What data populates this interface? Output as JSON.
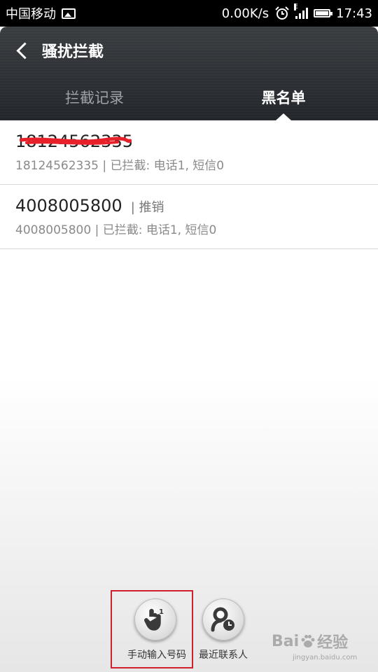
{
  "status_bar": {
    "carrier": "中国移动",
    "speed": "0.00K/s",
    "network": "E",
    "time": "17:43",
    "icons": [
      "image-icon",
      "alarm-clock-icon",
      "signal-icon",
      "battery-icon"
    ]
  },
  "header": {
    "title": "骚扰拦截",
    "tabs": [
      {
        "label": "拦截记录",
        "active": false
      },
      {
        "label": "黑名单",
        "active": true
      }
    ]
  },
  "blacklist": [
    {
      "number": "18124562335",
      "tag": "",
      "detail": "18124562335 | 已拦截: 电话1, 短信0",
      "redacted": true
    },
    {
      "number": "4008005800",
      "tag": "| 推销",
      "detail": "4008005800 | 已拦截: 电话1, 短信0",
      "redacted": false
    }
  ],
  "actions": [
    {
      "label": "手动输入号码",
      "icon": "hand-keypad-icon",
      "highlighted": true
    },
    {
      "label": "最近联系人",
      "icon": "recent-contact-icon",
      "highlighted": false
    }
  ],
  "colors": {
    "header_bg": "#2c2f33",
    "highlight_box": "#d0202a",
    "redaction": "#e8202a"
  },
  "watermark": {
    "brand": "Bai",
    "brand2": "经验",
    "url": "jingyan.baidu.com"
  }
}
